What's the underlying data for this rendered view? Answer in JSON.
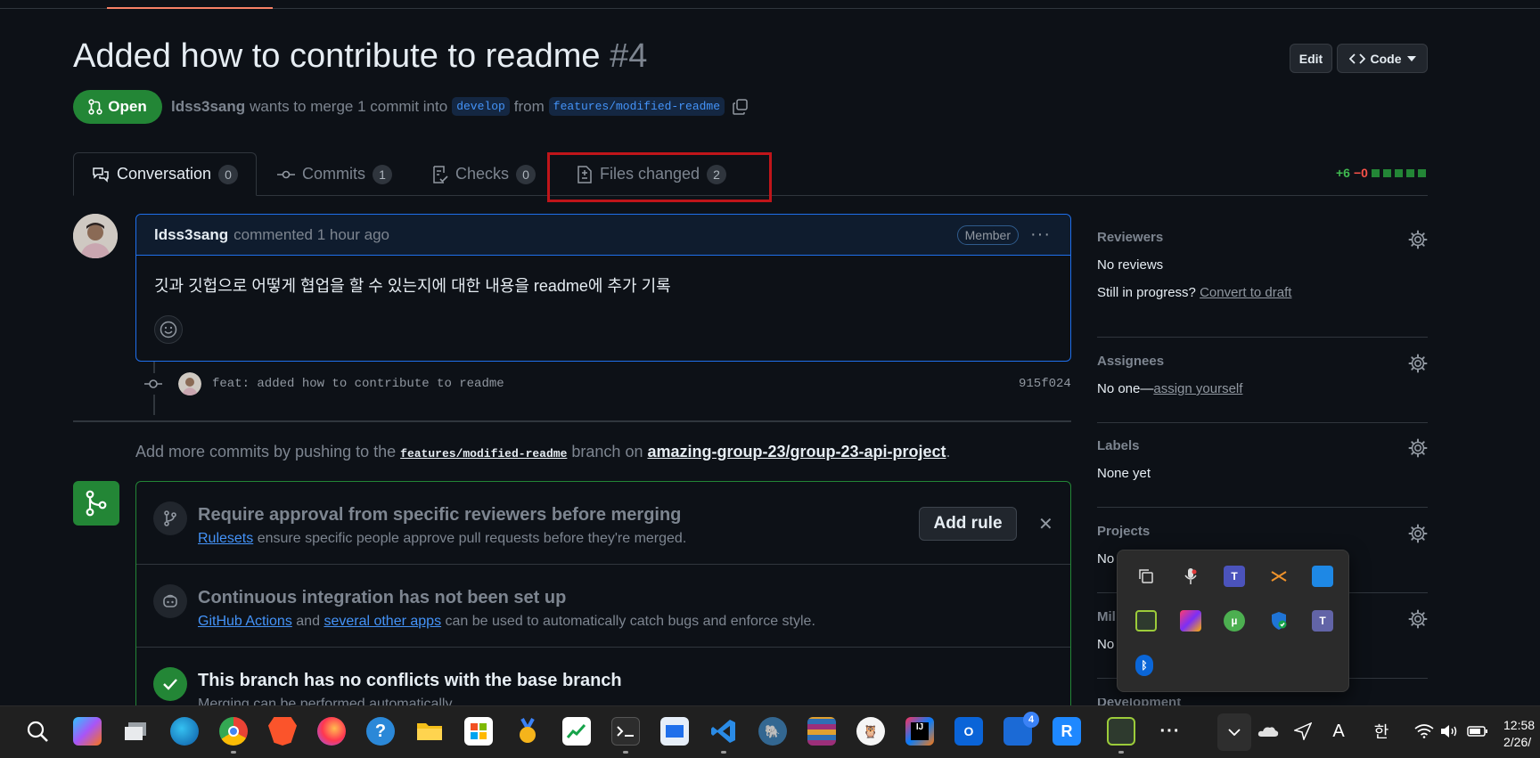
{
  "pr": {
    "title": "Added how to contribute to readme",
    "number": "#4",
    "state": "Open",
    "author": "ldss3sang",
    "meta_text": "wants to merge 1 commit into",
    "base_branch": "develop",
    "from_text": "from",
    "head_branch": "features/modified-readme"
  },
  "header": {
    "edit_label": "Edit",
    "code_label": "Code"
  },
  "tabs": [
    {
      "label": "Conversation",
      "count": "0"
    },
    {
      "label": "Commits",
      "count": "1"
    },
    {
      "label": "Checks",
      "count": "0"
    },
    {
      "label": "Files changed",
      "count": "2"
    }
  ],
  "diffstat": {
    "additions": "+6",
    "deletions": "−0"
  },
  "comment": {
    "author": "ldss3sang",
    "action": "commented 1 hour ago",
    "role_badge": "Member",
    "body": "깃과 깃헙으로 어떻게 협업을 할 수 있는지에 대한 내용을 readme에 추가 기록"
  },
  "commit": {
    "message": "feat: added how to contribute to readme",
    "sha": "915f024"
  },
  "push_hint": {
    "prefix": "Add more commits by pushing to the",
    "branch": "features/modified-readme",
    "middle": "branch on",
    "repo": "amazing-group-23/group-23-api-project",
    "suffix": "."
  },
  "merge_box": {
    "rule": {
      "title": "Require approval from specific reviewers before merging",
      "link": "Rulesets",
      "text": "ensure specific people approve pull requests before they're merged.",
      "button": "Add rule"
    },
    "ci": {
      "title": "Continuous integration has not been set up",
      "link1": "GitHub Actions",
      "and_text": "and",
      "link2": "several other apps",
      "text": "can be used to automatically catch bugs and enforce style."
    },
    "conflicts": {
      "title": "This branch has no conflicts with the base branch",
      "text": "Merging can be performed automatically."
    }
  },
  "sidebar": {
    "reviewers": {
      "heading": "Reviewers",
      "value": "No reviews",
      "progress_text": "Still in progress?",
      "progress_link": "Convert to draft"
    },
    "assignees": {
      "heading": "Assignees",
      "value": "No one—",
      "link": "assign yourself"
    },
    "labels": {
      "heading": "Labels",
      "value": "None yet"
    },
    "projects": {
      "heading": "Projects",
      "value": "No"
    },
    "milestone": {
      "heading": "Mil",
      "value": "No"
    },
    "development": {
      "heading": "Development"
    }
  },
  "tray": {
    "icons": [
      "copy-icon",
      "microphone-icon",
      "teams-icon",
      "sourcetree-icon",
      "app-blue-icon",
      "snagit-icon",
      "jetbrains-toolbox-icon",
      "utorrent-icon",
      "defender-icon",
      "teams-classic-icon",
      "bluetooth-icon"
    ]
  },
  "taskbar": {
    "icons": [
      "search-icon",
      "copilot-icon",
      "task-view-icon",
      "edge-icon",
      "chrome-icon",
      "brave-icon",
      "firefox-icon",
      "get-help-icon",
      "file-explorer-icon",
      "store-icon",
      "medal-icon",
      "robinhood-icon",
      "terminal-icon",
      "snipping-icon",
      "vscode-icon",
      "postgres-icon",
      "winrar-icon",
      "owl-icon",
      "intellij-icon",
      "outlook-icon",
      "todo-icon",
      "r-app-icon",
      "snagit-icon",
      "more-icon"
    ],
    "todo_badge": "4",
    "ime_mode": "A",
    "ime_korean": "한",
    "time": "12:58",
    "date": "2/26/"
  }
}
